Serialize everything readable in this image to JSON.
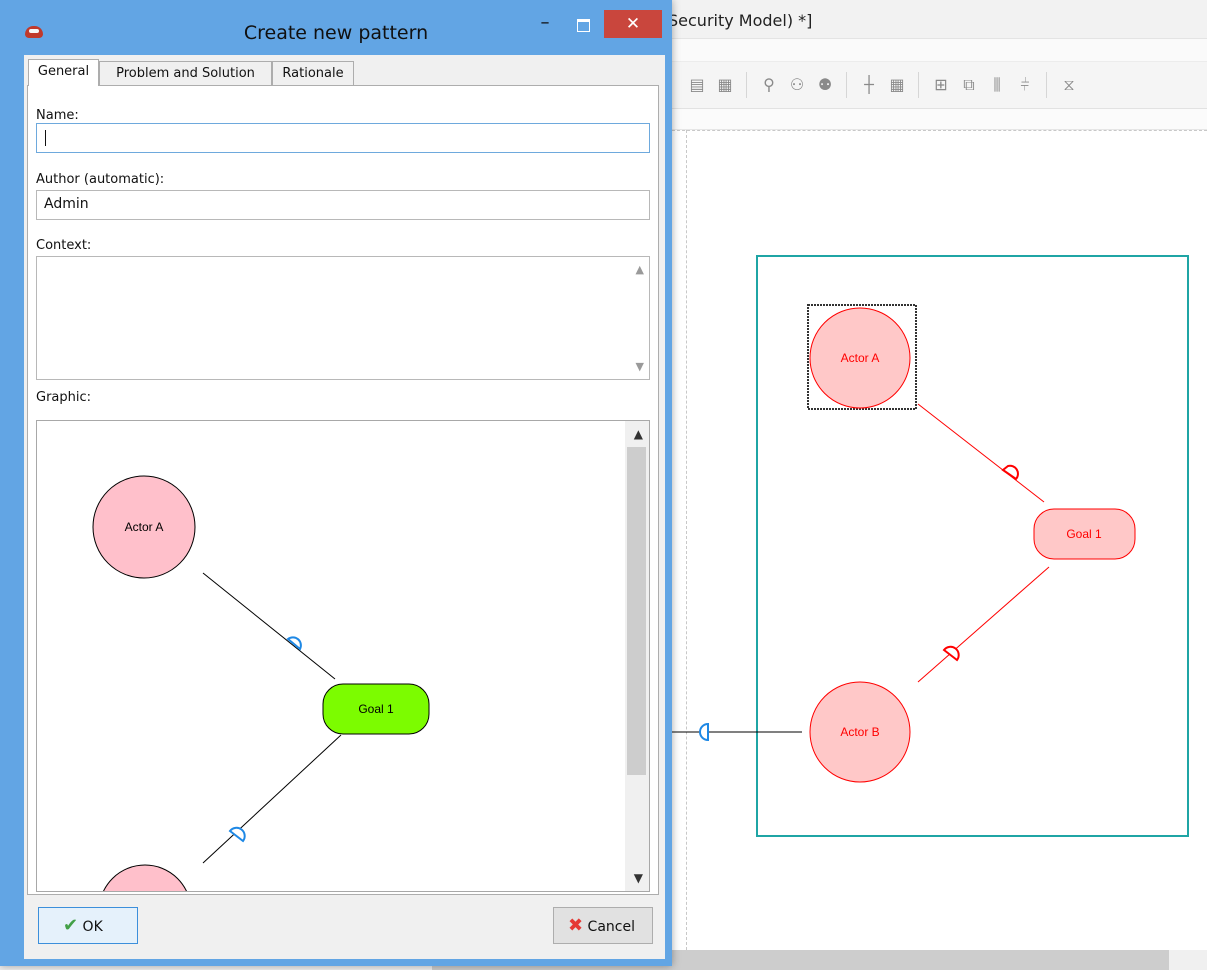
{
  "background_window": {
    "title_fragment": "Security Model) *]"
  },
  "dialog": {
    "title": "Create new pattern",
    "close_glyph": "✕",
    "minimize_glyph": "–",
    "tabs": [
      {
        "label": "General",
        "active": true
      },
      {
        "label": "Problem and Solution",
        "active": false
      },
      {
        "label": "Rationale",
        "active": false
      }
    ],
    "fields": {
      "name_label": "Name:",
      "name_value": "",
      "author_label": "Author (automatic):",
      "author_value": "Admin",
      "context_label": "Context:",
      "context_value": "",
      "graphic_label": "Graphic:"
    },
    "graphic": {
      "actor_a": "Actor A",
      "goal": "Goal 1",
      "goal_color": "#7cfc00",
      "actor_color": "#ffc0cb"
    },
    "buttons": {
      "ok_label": "OK",
      "cancel_label": "Cancel"
    }
  },
  "diagram": {
    "actor_a": "Actor A",
    "actor_b": "Actor B",
    "goal": "Goal 1",
    "boundary_color": "#1fa5a5",
    "element_color": "#ff0000",
    "fill_color": "#ffc8c8"
  },
  "colors": {
    "dialog_frame": "#62a5e4",
    "close_button": "#c9463d"
  }
}
